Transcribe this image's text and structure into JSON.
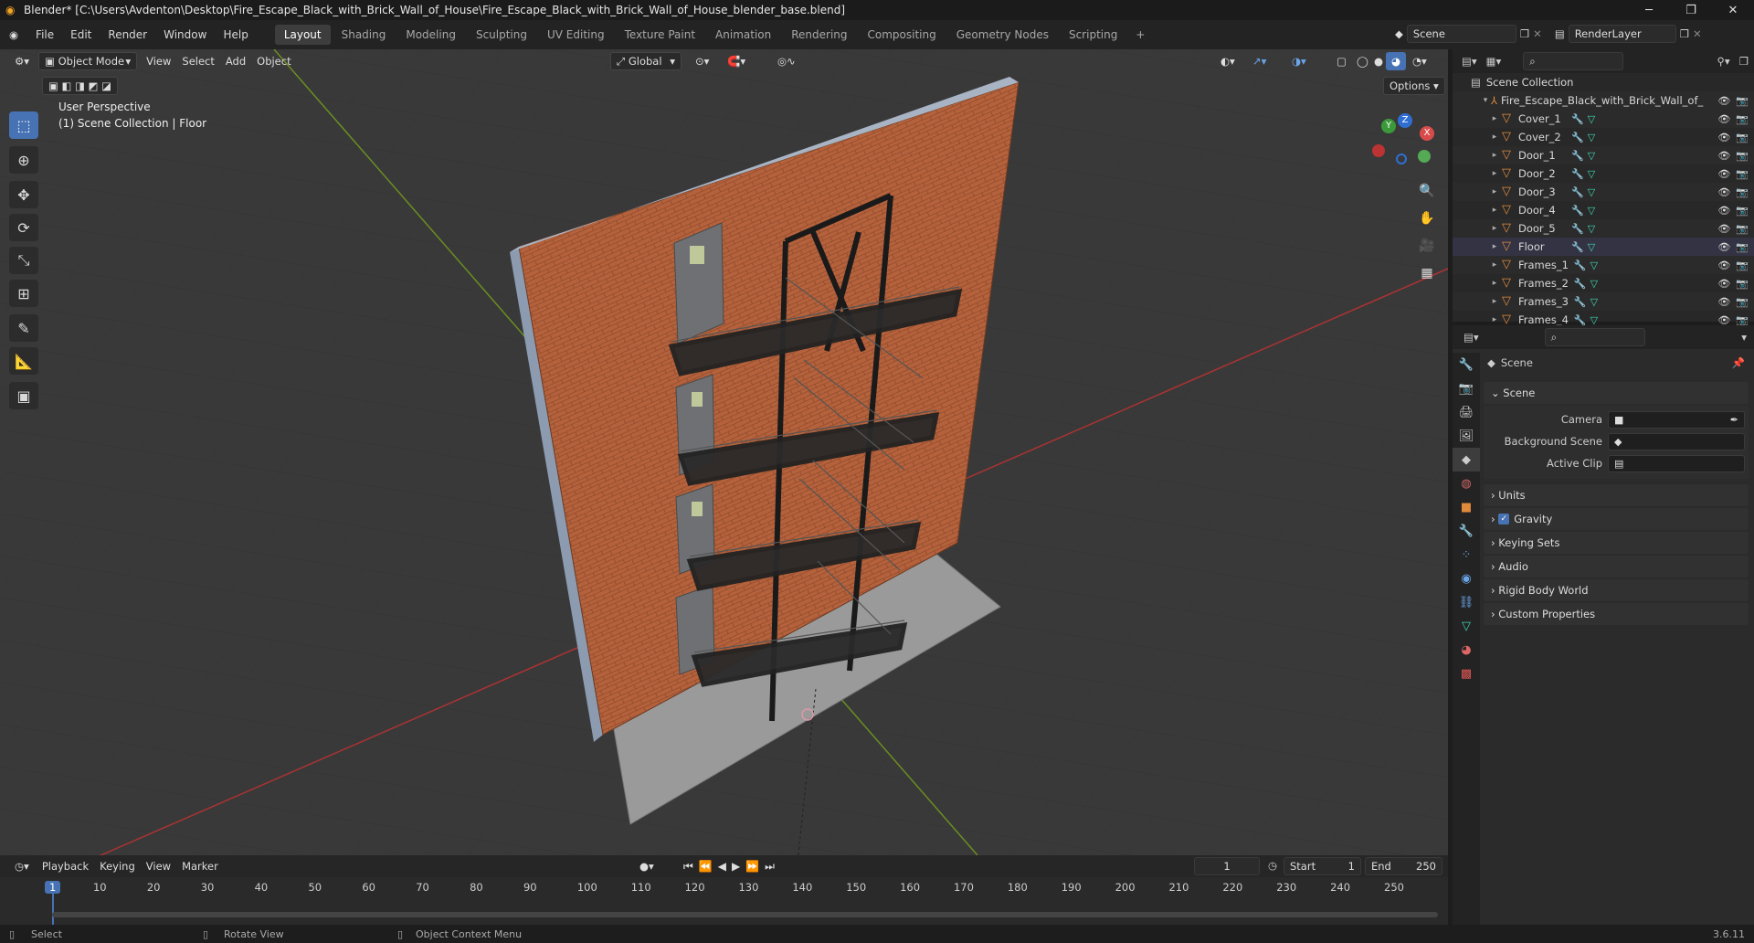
{
  "window": {
    "title": "Blender* [C:\\Users\\Avdenton\\Desktop\\Fire_Escape_Black_with_Brick_Wall_of_House\\Fire_Escape_Black_with_Brick_Wall_of_House_blender_base.blend]",
    "minimize": "─",
    "maximize": "❐",
    "close": "✕"
  },
  "menu": [
    "File",
    "Edit",
    "Render",
    "Window",
    "Help"
  ],
  "workspaces": [
    "Layout",
    "Shading",
    "Modeling",
    "Sculpting",
    "UV Editing",
    "Texture Paint",
    "Animation",
    "Rendering",
    "Compositing",
    "Geometry Nodes",
    "Scripting"
  ],
  "workspace_add": "+",
  "scene_selector": "Scene",
  "view_layer": "RenderLayer",
  "viewport": {
    "mode": "Object Mode",
    "menus": [
      "View",
      "Select",
      "Add",
      "Object"
    ],
    "transform_orientation": "Global",
    "options": "Options",
    "overlay_title": "User Perspective",
    "overlay_subtitle": "(1) Scene Collection | Floor",
    "gizmo": {
      "x": "X",
      "y": "Y",
      "z": "Z"
    }
  },
  "outliner": {
    "root": "Scene Collection",
    "collection": "Fire_Escape_Black_with_Brick_Wall_of_",
    "items": [
      "Cover_1",
      "Cover_2",
      "Door_1",
      "Door_2",
      "Door_3",
      "Door_4",
      "Door_5",
      "Floor",
      "Frames_1",
      "Frames_2",
      "Frames_3",
      "Frames_4"
    ]
  },
  "properties": {
    "header": "Scene",
    "section": "Scene",
    "camera_label": "Camera",
    "background_scene_label": "Background Scene",
    "active_clip_label": "Active Clip",
    "panels": [
      "Units",
      "Gravity",
      "Keying Sets",
      "Audio",
      "Rigid Body World",
      "Custom Properties"
    ],
    "gravity_checked": true
  },
  "timeline": {
    "menus": [
      "Playback",
      "Keying",
      "View",
      "Marker"
    ],
    "current_frame": "1",
    "start_label": "Start",
    "start": "1",
    "end_label": "End",
    "end": "250",
    "ticks": [
      "1",
      "10",
      "20",
      "30",
      "40",
      "50",
      "60",
      "70",
      "80",
      "90",
      "100",
      "110",
      "120",
      "130",
      "140",
      "150",
      "160",
      "170",
      "180",
      "190",
      "200",
      "210",
      "220",
      "230",
      "240",
      "250"
    ]
  },
  "status": {
    "select": "Select",
    "rotate": "Rotate View",
    "context": "Object Context Menu",
    "version": "3.6.11"
  },
  "colors": {
    "accent": "#4772b3",
    "object": "#e08b3c",
    "mesh": "#3fd6b0",
    "brick": "#b5623c",
    "floor": "#9a9a9a"
  }
}
